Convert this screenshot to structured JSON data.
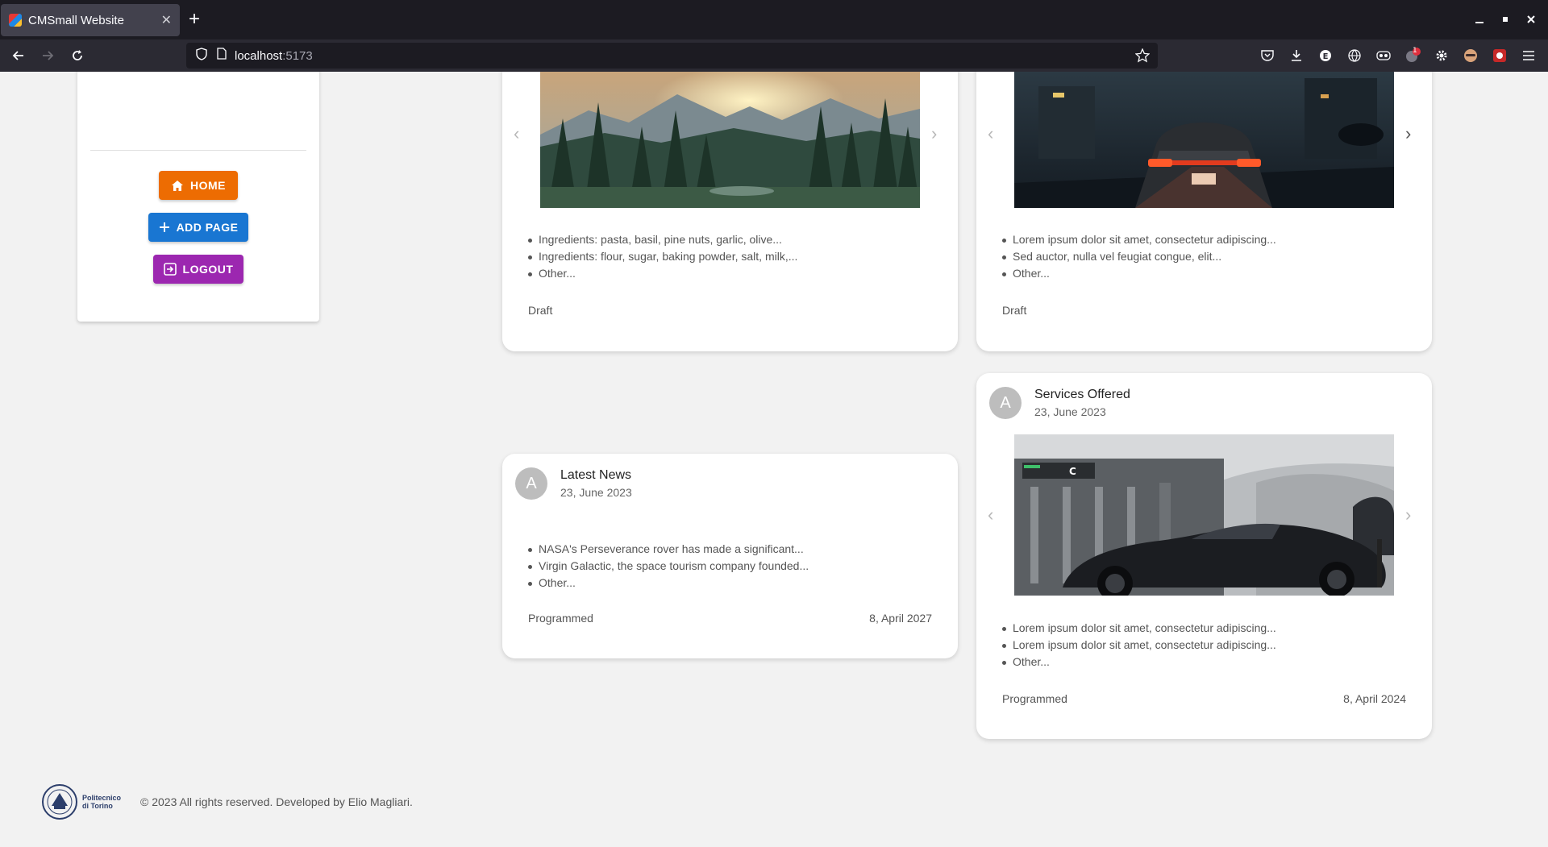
{
  "browser": {
    "tab_title": "CMSmall Website",
    "url_host": "localhost",
    "url_port": ":5173",
    "notification_badge": "1"
  },
  "sidebar": {
    "home_label": "HOME",
    "add_page_label": "ADD PAGE",
    "logout_label": "LOGOUT"
  },
  "cards": [
    {
      "items": [
        "Ingredients: pasta, basil, pine nuts, garlic, olive...",
        "Ingredients: flour, sugar, baking powder, salt, milk,...",
        "Other..."
      ],
      "status": "Draft",
      "image": "forest-mountain-sunset"
    },
    {
      "items": [
        "Lorem ipsum dolor sit amet, consectetur adipiscing...",
        "Sed auctor, nulla vel feugiat congue, elit...",
        "Other..."
      ],
      "status": "Draft",
      "image": "porsche-night-street"
    },
    {
      "avatar": "A",
      "title": "Latest News",
      "date": "23, June 2023",
      "items": [
        "NASA's Perseverance rover has made a significant...",
        "Virgin Galactic, the space tourism company founded...",
        "Other..."
      ],
      "status": "Programmed",
      "publication_date": "8, April 2027"
    },
    {
      "avatar": "A",
      "title": "Services Offered",
      "date": "23, June 2023",
      "items": [
        "Lorem ipsum dolor sit amet, consectetur adipiscing...",
        "Lorem ipsum dolor sit amet, consectetur adipiscing...",
        "Other..."
      ],
      "status": "Programmed",
      "publication_date": "8, April 2024",
      "image": "black-lamborghini-station"
    }
  ],
  "footer": {
    "logo_text": "Politecnico di Torino",
    "copyright": "© 2023 All rights reserved. Developed by Elio Magliari."
  }
}
